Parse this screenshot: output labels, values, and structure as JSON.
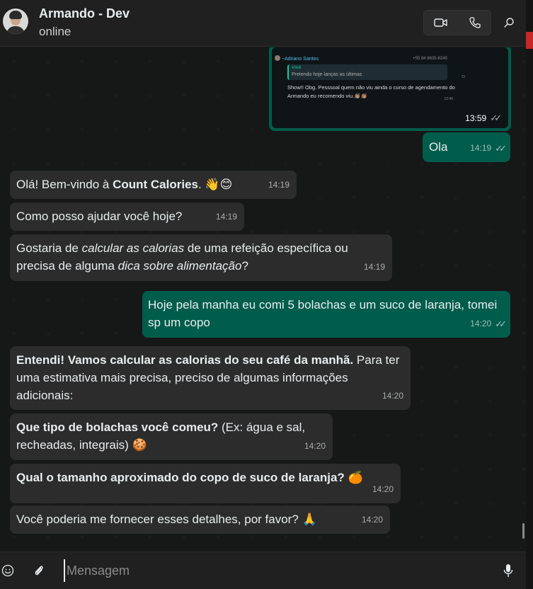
{
  "header": {
    "contact_name": "Armando - Dev",
    "status": "online"
  },
  "image_message": {
    "sender": "~Adriano Santos",
    "phone": "+55 84 8635-6245",
    "quote_name": "Você",
    "quote_text": "Pretendo hoje lanças as últimas",
    "body": "Show!! Obg. Pesssoal quem não viu ainda o curso de agendamento do Armando eu recomendo viu.👏🏽👏🏽",
    "inner_time": "12:40",
    "time": "13:59"
  },
  "messages": [
    {
      "dir": "out",
      "text": "Ola",
      "time": "14:19"
    },
    {
      "dir": "in",
      "time": "14:19"
    },
    {
      "dir": "in",
      "text": "Como posso ajudar você hoje?",
      "time": "14:19"
    },
    {
      "dir": "in",
      "time": "14:19"
    },
    {
      "dir": "out",
      "text": "Hoje pela manha eu comi 5 bolachas e um suco de laranja, tomei sp um copo",
      "time": "14:20"
    },
    {
      "dir": "in",
      "time": "14:20"
    },
    {
      "dir": "in",
      "time": "14:20"
    },
    {
      "dir": "in",
      "time": "14:20"
    },
    {
      "dir": "in",
      "text": "Você poderia me fornecer esses detalhes, por favor? 🙏",
      "time": "14:20"
    }
  ],
  "rich": {
    "m1_a": "Olá! Bem-vindo à ",
    "m1_b": "Count Calories",
    "m1_c": ". 👋😊",
    "m3_a": "Gostaria de ",
    "m3_b": "calcular as calorias",
    "m3_c": " de uma refeição específica ou precisa de alguma ",
    "m3_d": "dica sobre alimentação",
    "m3_e": "?",
    "m5_a": "Entendi! Vamos calcular as calorias do seu café da manhã.",
    "m5_b": " Para ter uma estimativa mais precisa, preciso de algumas informações adicionais:",
    "m6_a": "Que tipo de bolachas você comeu?",
    "m6_b": " (Ex: água e sal, recheadas, integrais) 🍪",
    "m7_a": "Qual o tamanho aproximado do copo de suco de laranja?",
    "m7_b": " 🍊"
  },
  "composer": {
    "placeholder": "Mensagem"
  },
  "colors": {
    "incoming_bubble": "#2c2c2c",
    "outgoing_bubble": "#005c4b",
    "background": "#161717"
  },
  "icons": [
    "video-icon",
    "phone-icon",
    "search-icon",
    "emoji-icon",
    "attach-icon",
    "mic-icon",
    "double-check-icon"
  ]
}
